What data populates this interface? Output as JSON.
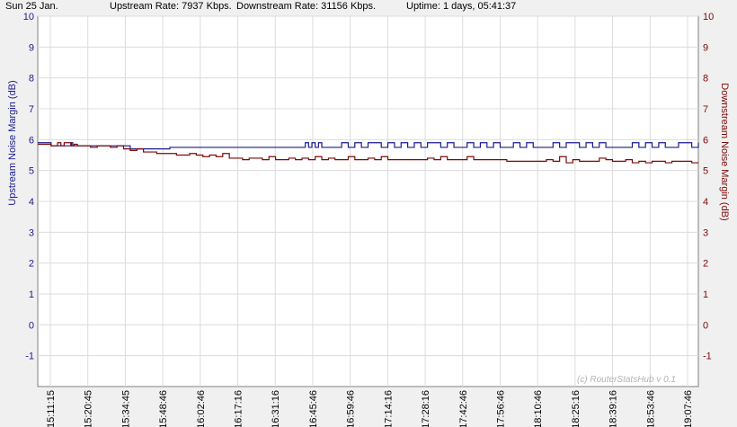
{
  "header": {
    "date": "Sun 25 Jan.",
    "upstream": "Upstream Rate: 7937 Kbps.",
    "downstream": "Downstream Rate: 31156 Kbps.",
    "uptime": "Uptime: 1 days, 05:41:37"
  },
  "watermark": "(c) RouterStatsHub v 0.1",
  "colors": {
    "upstream": "#1a1a8c",
    "downstream": "#7a0a0a",
    "plot_bg": "#ffffff",
    "grid": "#dcdcdc"
  },
  "chart_data": {
    "type": "line",
    "ylabel_left": "Upstream Noise Margin (dB)",
    "ylabel_right": "Downstream Noise Margin (dB)",
    "ylim": [
      -2,
      10
    ],
    "yticks": [
      -1,
      0,
      1,
      2,
      3,
      4,
      5,
      6,
      7,
      8,
      9,
      10
    ],
    "grid": true,
    "x_tick_labels": [
      "15:11:15",
      "15:20:45",
      "15:34:45",
      "15:48:46",
      "16:02:46",
      "16:17:16",
      "16:31:16",
      "16:45:46",
      "16:59:46",
      "17:14:16",
      "17:28:16",
      "17:42:46",
      "17:56:46",
      "18:10:46",
      "18:25:16",
      "18:39:16",
      "18:53:46",
      "19:07:46"
    ],
    "series": [
      {
        "name": "Upstream",
        "x": [
          0,
          2,
          2.02,
          5,
          5.1,
          5.3,
          8,
          9,
          13,
          14,
          16,
          17,
          20,
          22,
          26,
          27,
          30,
          32,
          37,
          40,
          40.5,
          41,
          41.5,
          42,
          42.5,
          43,
          44,
          45,
          46,
          47,
          48,
          49,
          50,
          51,
          52,
          53,
          54,
          55,
          56,
          57,
          58,
          59,
          60,
          61,
          62,
          63,
          64,
          65,
          66,
          67,
          68,
          69,
          70,
          71,
          72,
          73,
          74,
          75,
          76,
          77,
          78,
          79,
          80,
          81,
          82,
          83,
          84,
          85,
          86,
          87,
          88,
          89,
          90,
          91,
          92,
          93,
          94,
          95,
          96,
          97,
          98,
          99,
          100
        ],
        "y": [
          5.9,
          5.9,
          5.8,
          5.8,
          5.9,
          5.8,
          5.8,
          5.8,
          5.8,
          5.7,
          5.7,
          5.7,
          5.75,
          5.75,
          5.75,
          5.75,
          5.75,
          5.75,
          5.75,
          5.75,
          5.9,
          5.75,
          5.9,
          5.75,
          5.9,
          5.75,
          5.75,
          5.75,
          5.9,
          5.75,
          5.9,
          5.75,
          5.9,
          5.9,
          5.75,
          5.9,
          5.75,
          5.9,
          5.75,
          5.9,
          5.75,
          5.9,
          5.9,
          5.75,
          5.9,
          5.75,
          5.75,
          5.9,
          5.75,
          5.9,
          5.75,
          5.9,
          5.75,
          5.75,
          5.9,
          5.75,
          5.9,
          5.75,
          5.75,
          5.75,
          5.9,
          5.75,
          5.9,
          5.9,
          5.75,
          5.9,
          5.75,
          5.9,
          5.75,
          5.75,
          5.75,
          5.75,
          5.9,
          5.75,
          5.9,
          5.75,
          5.9,
          5.75,
          5.75,
          5.9,
          5.9,
          5.75,
          5.9
        ]
      },
      {
        "name": "Downstream",
        "x": [
          0,
          2,
          2.02,
          3,
          3.5,
          4,
          5,
          5.5,
          6,
          7,
          8,
          9,
          10,
          11,
          12,
          13,
          14,
          15,
          16,
          17,
          18,
          19,
          20,
          21,
          22,
          23,
          24,
          25,
          26,
          27,
          28,
          29,
          30,
          31,
          32,
          33,
          34,
          35,
          36,
          37,
          38,
          39,
          40,
          41,
          42,
          43,
          44,
          45,
          46,
          47,
          48,
          49,
          50,
          51,
          52,
          53,
          54,
          55,
          56,
          57,
          58,
          59,
          60,
          61,
          62,
          63,
          64,
          65,
          66,
          67,
          68,
          69,
          70,
          71,
          72,
          73,
          74,
          75,
          76,
          77,
          78,
          79,
          80,
          81,
          82,
          83,
          84,
          85,
          86,
          87,
          88,
          89,
          90,
          91,
          92,
          93,
          94,
          95,
          96,
          97,
          98,
          99,
          100
        ],
        "y": [
          5.85,
          5.85,
          5.8,
          5.9,
          5.8,
          5.9,
          5.8,
          5.85,
          5.8,
          5.8,
          5.75,
          5.8,
          5.8,
          5.75,
          5.8,
          5.7,
          5.65,
          5.7,
          5.6,
          5.6,
          5.55,
          5.55,
          5.55,
          5.5,
          5.5,
          5.55,
          5.5,
          5.45,
          5.5,
          5.45,
          5.55,
          5.4,
          5.4,
          5.35,
          5.4,
          5.4,
          5.35,
          5.45,
          5.35,
          5.35,
          5.4,
          5.35,
          5.4,
          5.35,
          5.45,
          5.35,
          5.4,
          5.35,
          5.35,
          5.45,
          5.35,
          5.35,
          5.4,
          5.35,
          5.45,
          5.35,
          5.35,
          5.35,
          5.35,
          5.35,
          5.35,
          5.4,
          5.35,
          5.45,
          5.35,
          5.35,
          5.35,
          5.45,
          5.35,
          5.35,
          5.35,
          5.35,
          5.35,
          5.3,
          5.3,
          5.3,
          5.3,
          5.3,
          5.3,
          5.35,
          5.3,
          5.45,
          5.25,
          5.35,
          5.3,
          5.3,
          5.3,
          5.4,
          5.35,
          5.3,
          5.3,
          5.35,
          5.25,
          5.3,
          5.25,
          5.3,
          5.3,
          5.25,
          5.3,
          5.3,
          5.3,
          5.25,
          5.25
        ]
      }
    ]
  }
}
